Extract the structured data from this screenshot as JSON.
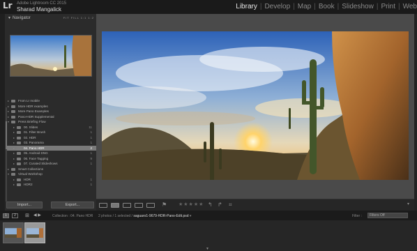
{
  "identity": {
    "logo": "Lr",
    "app_name": "Adobe Lightroom CC 2015",
    "user_name": "Sharad Mangalick"
  },
  "modules": [
    "Library",
    "Develop",
    "Map",
    "Book",
    "Slideshow",
    "Print",
    "Web"
  ],
  "active_module": "Library",
  "navigator": {
    "title": "Navigator",
    "options": "FIT  FILL  1:1  1:2"
  },
  "collections": [
    {
      "label": "From Lr mobile",
      "count": "",
      "level": 1,
      "type": "collection"
    },
    {
      "label": "More HDR examples",
      "count": "",
      "level": 1,
      "type": "collection"
    },
    {
      "label": "More Pano Examples",
      "count": "",
      "level": 1,
      "type": "collection"
    },
    {
      "label": "Pano-HDR Supplemental",
      "count": "",
      "level": 1,
      "type": "collection"
    },
    {
      "label": "Press Briefing Flow",
      "count": "",
      "level": 1,
      "type": "set",
      "open": true
    },
    {
      "label": "00. Slides",
      "count": "11",
      "level": 2,
      "type": "collection"
    },
    {
      "label": "01. Filter Brush",
      "count": "1",
      "level": 2,
      "type": "collection"
    },
    {
      "label": "02. HDR",
      "count": "1",
      "level": 2,
      "type": "collection"
    },
    {
      "label": "03. Panorama",
      "count": "1",
      "level": 2,
      "type": "collection"
    },
    {
      "label": "04. Pano HDR",
      "count": "2",
      "level": 2,
      "type": "collection",
      "selected": true
    },
    {
      "label": "05. Android DNG",
      "count": "1",
      "level": 2,
      "type": "collection"
    },
    {
      "label": "06. Face Tagging",
      "count": "9",
      "level": 2,
      "type": "collection"
    },
    {
      "label": "07. Curated Slideshows",
      "count": "1",
      "level": 2,
      "type": "collection"
    },
    {
      "label": "Smart Collections",
      "count": "",
      "level": 1,
      "type": "set"
    },
    {
      "label": "Virtual Workshop",
      "count": "",
      "level": 1,
      "type": "set",
      "open": true
    },
    {
      "label": "HDR",
      "count": "1",
      "level": 2,
      "type": "collection"
    },
    {
      "label": "HDR2",
      "count": "1",
      "level": 2,
      "type": "collection"
    }
  ],
  "buttons": {
    "import": "Import...",
    "export": "Export..."
  },
  "filmstrip": {
    "screen1": "1",
    "screen2": "2",
    "collection_path": "Collection : 04. Pano HDR",
    "count_text": "2 photos / 1 selected /",
    "filename": "saguaro1-9679-HDR-Pano-Edit.psd",
    "filename_suffix": "▾",
    "filter_label": "Filter :",
    "filter_value": "Filters Off",
    "thumbnails": [
      {
        "selected": false
      },
      {
        "selected": true
      }
    ]
  },
  "colors": {
    "active_module": "#e8e8e8",
    "selected_row": "#7a7a7a",
    "panel_bg": "#2b2b2b",
    "main_bg": "#4a4a4a"
  }
}
